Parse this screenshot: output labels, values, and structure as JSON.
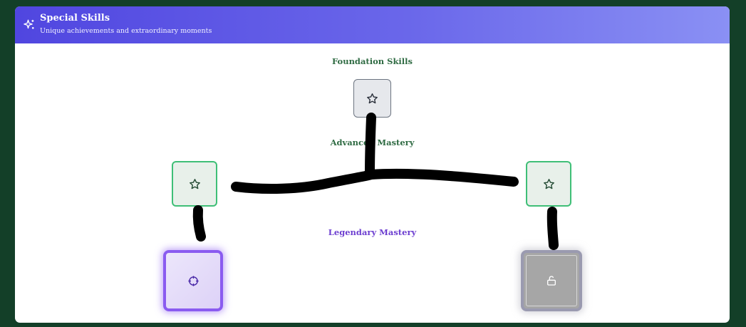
{
  "header": {
    "title": "Special Skills",
    "subtitle": "Unique achievements and extraordinary moments",
    "icon": "sparkles-icon"
  },
  "tiers": [
    {
      "label": "Foundation Skills"
    },
    {
      "label": "Advanced Mastery"
    },
    {
      "label": "Legendary Mastery"
    }
  ],
  "skills": {
    "foundation": {
      "icon": "star-icon",
      "state": "available"
    },
    "advanced_left": {
      "icon": "star-icon",
      "state": "unlocked"
    },
    "advanced_right": {
      "icon": "star-icon",
      "state": "unlocked"
    },
    "legendary_left": {
      "icon": "crosshair-icon",
      "state": "active"
    },
    "legendary_right": {
      "icon": "unlock-icon",
      "state": "locked"
    }
  },
  "colors": {
    "page_background": "#133f28",
    "header_gradient_start": "#5046e0",
    "header_gradient_end": "#8a90f4",
    "tier_label_green": "#2f6b43",
    "tier_label_purple": "#6d3fd0",
    "advanced_border": "#3fbf77",
    "legendary_border": "#8a5bf0",
    "connector_stroke": "#000000"
  }
}
